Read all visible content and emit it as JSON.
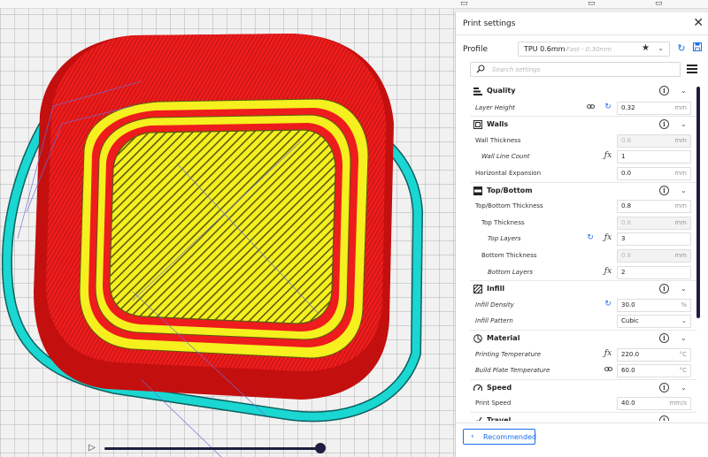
{
  "panel": {
    "title": "Print settings",
    "profile_label": "Profile",
    "profile_name": "TPU 0.6mm",
    "profile_sub": "Fast - 0.30mm",
    "search_placeholder": "Search settings",
    "recommended_label": "Recommended",
    "accent_color": "#196ef0"
  },
  "settings": [
    {
      "kind": "category",
      "label": "Quality",
      "icon": "quality-bars-icon"
    },
    {
      "kind": "setting",
      "label": "Layer Height",
      "indent": 0,
      "italic": true,
      "value": "0.32",
      "unit": "mm",
      "icons": [
        "link",
        "reset"
      ]
    },
    {
      "kind": "category",
      "label": "Walls",
      "icon": "walls-icon"
    },
    {
      "kind": "setting",
      "label": "Wall Thickness",
      "indent": 0,
      "value": "0.8",
      "unit": "mm",
      "disabled": true
    },
    {
      "kind": "setting",
      "label": "Wall Line Count",
      "indent": 1,
      "italic": true,
      "value": "1",
      "unit": "",
      "icons": [
        "fx"
      ]
    },
    {
      "kind": "setting",
      "label": "Horizontal Expansion",
      "indent": 0,
      "value": "0.0",
      "unit": "mm"
    },
    {
      "kind": "category",
      "label": "Top/Bottom",
      "icon": "top-bottom-icon"
    },
    {
      "kind": "setting",
      "label": "Top/Bottom Thickness",
      "indent": 0,
      "value": "0.8",
      "unit": "mm"
    },
    {
      "kind": "setting",
      "label": "Top Thickness",
      "indent": 1,
      "value": "0.8",
      "unit": "mm",
      "disabled": true
    },
    {
      "kind": "setting",
      "label": "Top Layers",
      "indent": 2,
      "italic": true,
      "value": "3",
      "unit": "",
      "icons": [
        "reset",
        "fx"
      ]
    },
    {
      "kind": "setting",
      "label": "Bottom Thickness",
      "indent": 1,
      "value": "0.8",
      "unit": "mm",
      "disabled": true
    },
    {
      "kind": "setting",
      "label": "Bottom Layers",
      "indent": 2,
      "italic": true,
      "value": "2",
      "unit": "",
      "icons": [
        "fx"
      ]
    },
    {
      "kind": "category",
      "label": "Infill",
      "icon": "infill-icon"
    },
    {
      "kind": "setting",
      "label": "Infill Density",
      "indent": 0,
      "italic": true,
      "value": "30.0",
      "unit": "%",
      "icons": [
        "reset"
      ]
    },
    {
      "kind": "setting",
      "label": "Infill Pattern",
      "indent": 0,
      "italic": true,
      "value": "Cubic",
      "unit": "",
      "dropdown": true
    },
    {
      "kind": "category",
      "label": "Material",
      "icon": "material-icon"
    },
    {
      "kind": "setting",
      "label": "Printing Temperature",
      "indent": 0,
      "italic": true,
      "value": "220.0",
      "unit": "°C",
      "icons": [
        "fx"
      ]
    },
    {
      "kind": "setting",
      "label": "Build Plate Temperature",
      "indent": 0,
      "italic": true,
      "value": "60.0",
      "unit": "°C",
      "icons": [
        "link"
      ]
    },
    {
      "kind": "category",
      "label": "Speed",
      "icon": "speed-icon"
    },
    {
      "kind": "setting",
      "label": "Print Speed",
      "indent": 0,
      "value": "40.0",
      "unit": "mm/s"
    },
    {
      "kind": "category",
      "label": "Travel",
      "icon": "travel-icon"
    }
  ],
  "colors": {
    "wall_red": "#ee1c1c",
    "inner_yellow": "#f5f01e",
    "skirt_cyan": "#1ad7d2",
    "slider": "#1e1e40"
  }
}
